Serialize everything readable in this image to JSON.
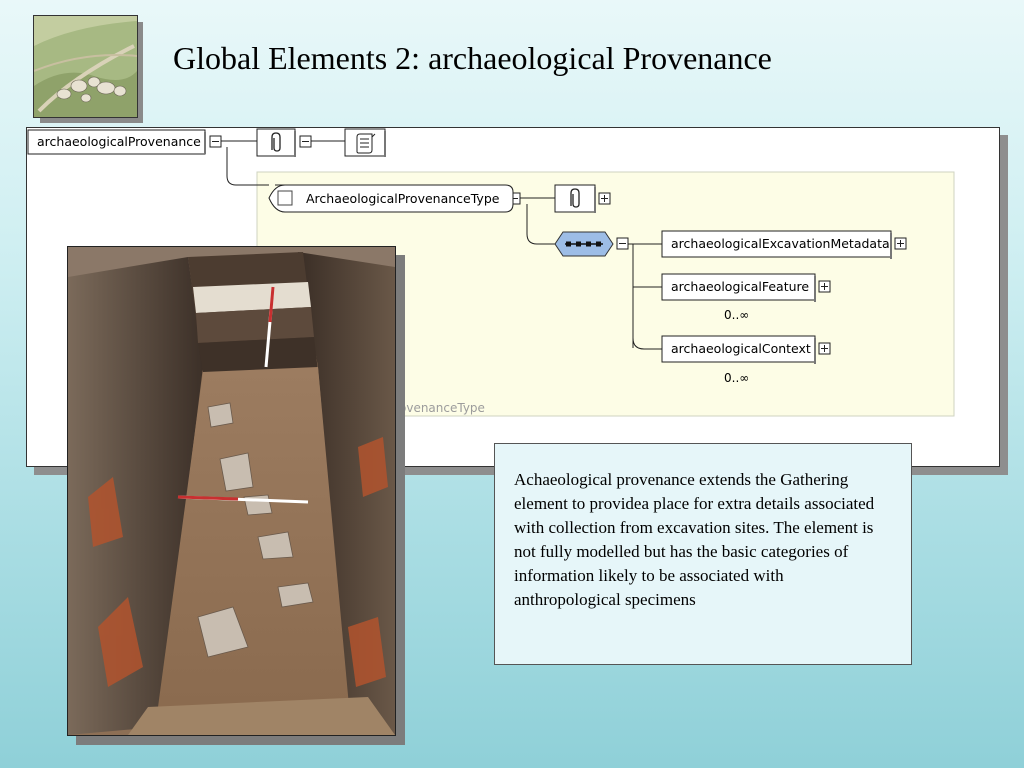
{
  "slide": {
    "title": "Global Elements 2:  archaeological Provenance"
  },
  "diagram": {
    "root_element": "archaeologicalProvenance",
    "type_name": "ArchaeologicalProvenanceType",
    "type_watermark": "ovenanceType",
    "children": [
      {
        "name": "archaeologicalExcavationMetadata",
        "cardinality": ""
      },
      {
        "name": "archaeologicalFeature",
        "cardinality": "0..∞"
      },
      {
        "name": "archaeologicalContext",
        "cardinality": "0..∞"
      }
    ],
    "icons": [
      "annotation-icon",
      "documentation-icon",
      "sequence-compositor-icon",
      "expand-icon",
      "collapse-icon"
    ]
  },
  "caption": {
    "text": "Achaeological provenance extends the Gathering element to providea place for extra details associated with collection from excavation sites. The element is not fully modelled but has the basic categories of information likely to be associated with anthropological specimens"
  },
  "images": {
    "thumbnail": "aerial-stone-circle-photo",
    "photo": "excavation-trench-photo"
  }
}
